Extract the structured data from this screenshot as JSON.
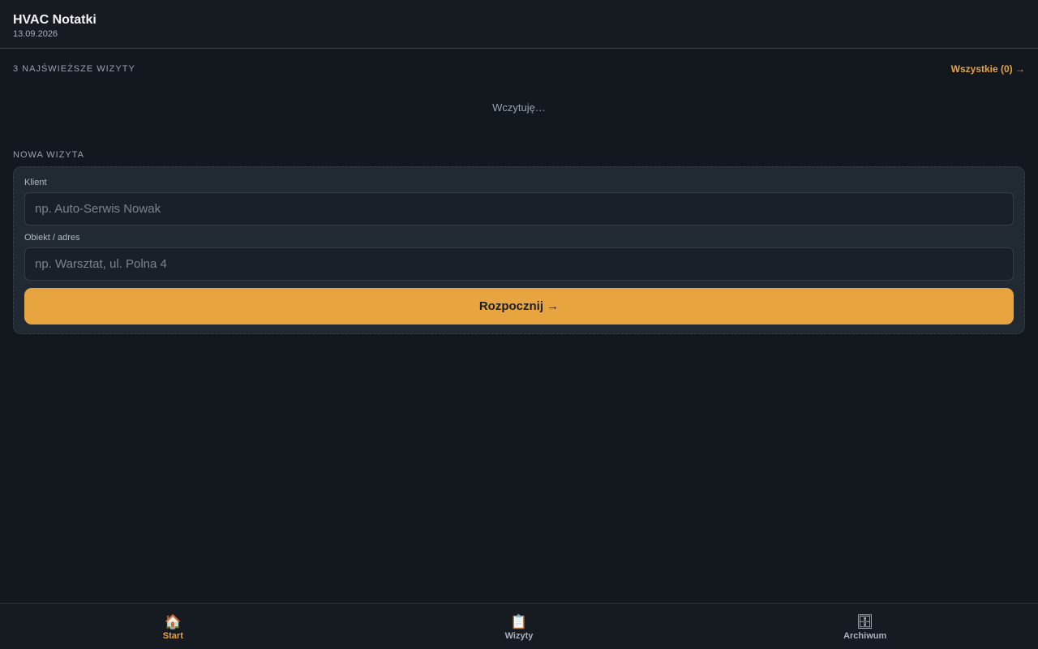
{
  "header": {
    "title": "HVAC Notatki",
    "date": "13.09.2026"
  },
  "recent": {
    "label": "3 NAJŚWIEŻSZE WIZYTY",
    "all_link": "Wszystkie (0) →",
    "loading": "Wczytuję…"
  },
  "new_visit": {
    "label": "NOWA WIZYTA",
    "client_label": "Klient",
    "client_placeholder": "np. Auto-Serwis Nowak",
    "client_value": "",
    "object_label": "Obiekt / adres",
    "object_placeholder": "np. Warsztat, ul. Polna 4",
    "object_value": "",
    "start_button": "Rozpocznij →"
  },
  "nav": {
    "items": [
      {
        "label": "Start",
        "icon": "home-icon",
        "glyph": "🏠",
        "active": true
      },
      {
        "label": "Wizyty",
        "icon": "clipboard-icon",
        "glyph": "📋",
        "active": false
      },
      {
        "label": "Archiwum",
        "icon": "file-cabinet-icon",
        "glyph": "🗄",
        "active": false
      }
    ]
  },
  "colors": {
    "accent": "#e8a43f",
    "background": "#13171e",
    "card": "#212a33"
  }
}
